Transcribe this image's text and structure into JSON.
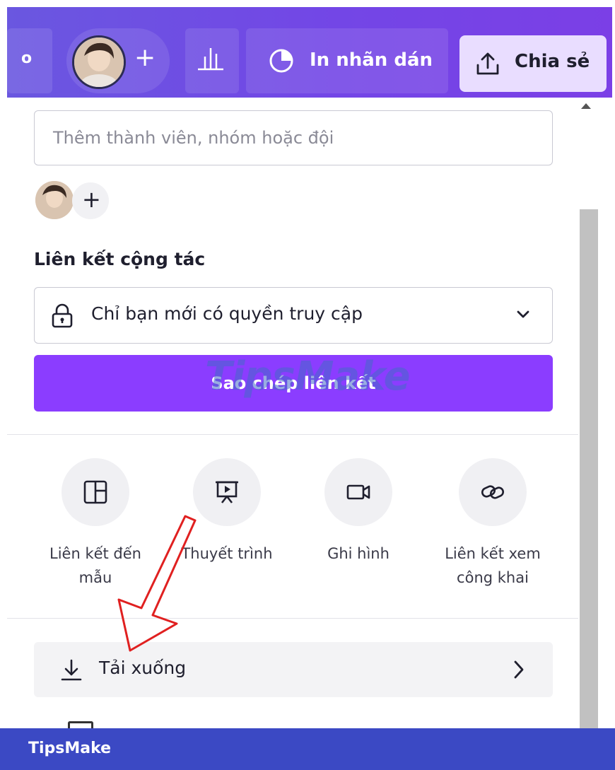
{
  "topbar": {
    "truncated_text": "o",
    "add_label": "+",
    "print_label": "In nhãn dán",
    "share_label": "Chia sẻ"
  },
  "invite": {
    "placeholder": "Thêm thành viên, nhóm hoặc đội",
    "add_label": "+"
  },
  "collab": {
    "title": "Liên kết cộng tác",
    "access_value": "Chỉ bạn mới có quyền truy cập",
    "copy_button": "Sao chép liên kết"
  },
  "watermark_text": "TipsMake",
  "share_options": [
    {
      "label": "Liên kết đến mẫu",
      "icon": "template-icon"
    },
    {
      "label": "Thuyết trình",
      "icon": "present-icon"
    },
    {
      "label": "Ghi hình",
      "icon": "video-camera-icon"
    },
    {
      "label": "Liên kết xem công khai",
      "icon": "link-icon"
    }
  ],
  "download": {
    "label": "Tải xuống"
  },
  "footer": {
    "brand": "TipsMake"
  },
  "colors": {
    "header_purple": "#7346e6",
    "primary_button": "#8b3dff",
    "share_button_bg": "#e9ddff",
    "footer_blue": "#3b49c4",
    "annotation_red": "#e02020"
  }
}
